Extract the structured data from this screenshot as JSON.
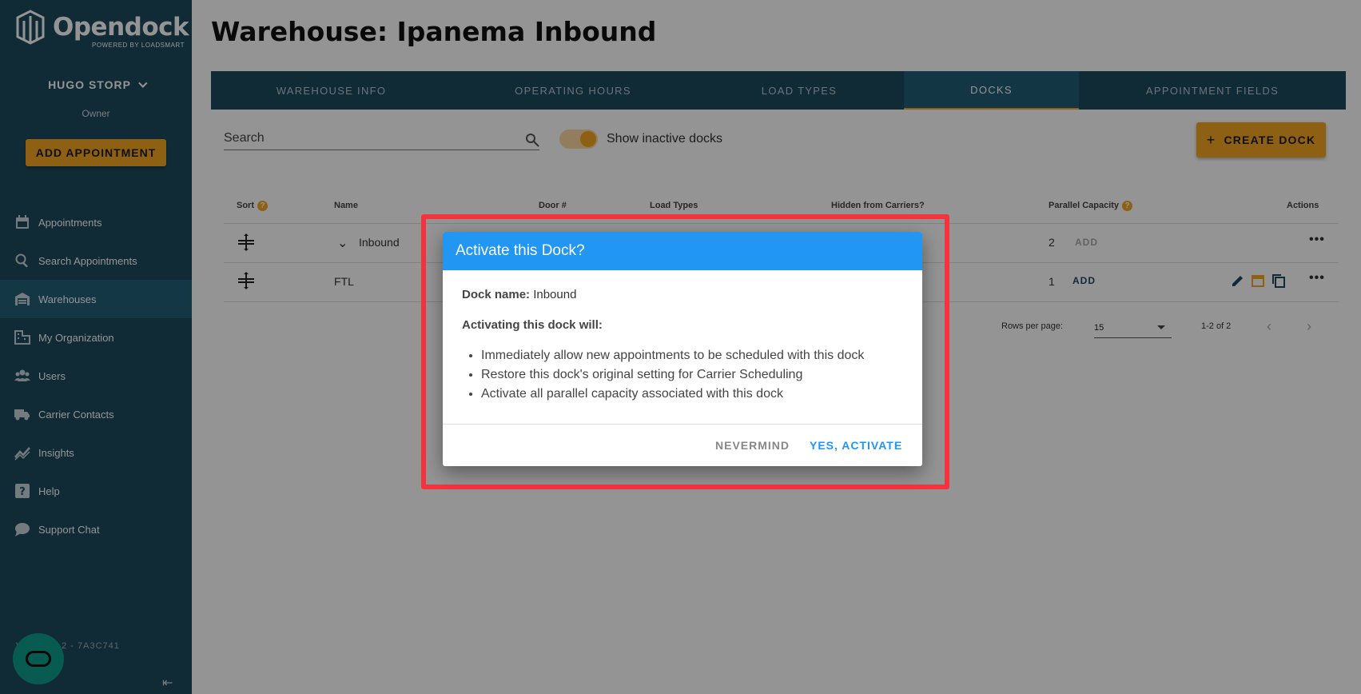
{
  "app": {
    "logo_text": "Opendock",
    "logo_sub": "POWERED BY LOADSMART"
  },
  "sidebar": {
    "user_name": "HUGO STORP",
    "role": "Owner",
    "add_appointment": "ADD APPOINTMENT",
    "items": [
      {
        "label": "Appointments",
        "icon": "calendar-icon"
      },
      {
        "label": "Search Appointments",
        "icon": "search-icon"
      },
      {
        "label": "Warehouses",
        "icon": "warehouse-icon",
        "active": true
      },
      {
        "label": "My Organization",
        "icon": "building-icon"
      },
      {
        "label": "Users",
        "icon": "users-icon"
      },
      {
        "label": "Carrier Contacts",
        "icon": "truck-icon"
      },
      {
        "label": "Insights",
        "icon": "chart-icon"
      },
      {
        "label": "Help",
        "icon": "help-icon"
      },
      {
        "label": "Support Chat",
        "icon": "chat-icon"
      }
    ],
    "version": "VA V3.20.2 - 7A3C741"
  },
  "main": {
    "title": "Warehouse: Ipanema Inbound",
    "tabs": [
      "WAREHOUSE INFO",
      "OPERATING HOURS",
      "LOAD TYPES",
      "DOCKS",
      "APPOINTMENT FIELDS"
    ],
    "active_tab": "DOCKS",
    "search_placeholder": "Search",
    "toggle_label": "Show inactive docks",
    "create_dock": "CREATE DOCK",
    "table": {
      "headers": {
        "sort": "Sort",
        "name": "Name",
        "door": "Door #",
        "load_types": "Load Types",
        "hidden": "Hidden from Carriers?",
        "capacity": "Parallel Capacity",
        "actions": "Actions"
      },
      "rows": [
        {
          "name": "Inbound",
          "capacity": "2",
          "add": "ADD"
        },
        {
          "name": "FTL",
          "capacity": "1",
          "add": "ADD"
        }
      ]
    },
    "pagination": {
      "rows_per_page_label": "Rows per page:",
      "rows_per_page": "15",
      "range": "1-2 of 2"
    }
  },
  "dialog": {
    "title": "Activate this Dock?",
    "dock_name_label": "Dock name:",
    "dock_name": "Inbound",
    "will_label": "Activating this dock will:",
    "bullets": [
      "Immediately allow new appointments to be scheduled with this dock",
      "Restore this dock's original setting for Carrier Scheduling",
      "Activate all parallel capacity associated with this dock"
    ],
    "cancel": "NEVERMIND",
    "confirm": "YES, ACTIVATE"
  },
  "colors": {
    "sidebar": "#1d4a5e",
    "accent": "#f5a623",
    "primary": "#2196f3",
    "highlight": "#f5333f"
  }
}
